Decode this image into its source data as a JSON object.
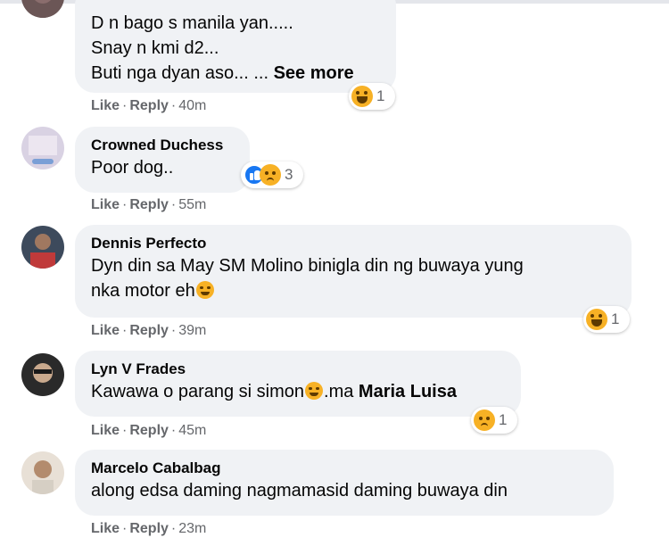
{
  "comments": [
    {
      "author": "",
      "lines": [
        "D n bago s manila yan.....",
        "Snay n kmi d2...",
        "Buti nga dyan aso... ..."
      ],
      "see_more": "See more",
      "reaction_count": "1",
      "time": "40m"
    },
    {
      "author": "Crowned Duchess",
      "lines": [
        "Poor dog.."
      ],
      "reaction_count": "3",
      "time": "55m"
    },
    {
      "author": "Dennis Perfecto",
      "lines": [
        "Dyn din sa May SM Molino binigla din ng buwaya yung",
        "nka motor eh"
      ],
      "reaction_count": "1",
      "time": "39m"
    },
    {
      "author": "Lyn V Frades",
      "lines": [
        "Kawawa o parang si simon",
        ".ma"
      ],
      "mention": "Maria Luisa",
      "reaction_count": "1",
      "time": "45m"
    },
    {
      "author": "Marcelo Cabalbag",
      "lines": [
        "along edsa daming nagmamasid daming buwaya din"
      ],
      "time": "23m"
    }
  ],
  "actions": {
    "like": "Like",
    "reply": "Reply",
    "dot": "·"
  },
  "colors": {
    "bubble": "#f0f2f5",
    "meta": "#65676b",
    "like_blue": "#1877f2",
    "emoji_yellow": "#f7b125"
  },
  "icons": {
    "haha": "haha-reaction-icon",
    "sad": "sad-reaction-icon",
    "like": "like-reaction-icon"
  }
}
